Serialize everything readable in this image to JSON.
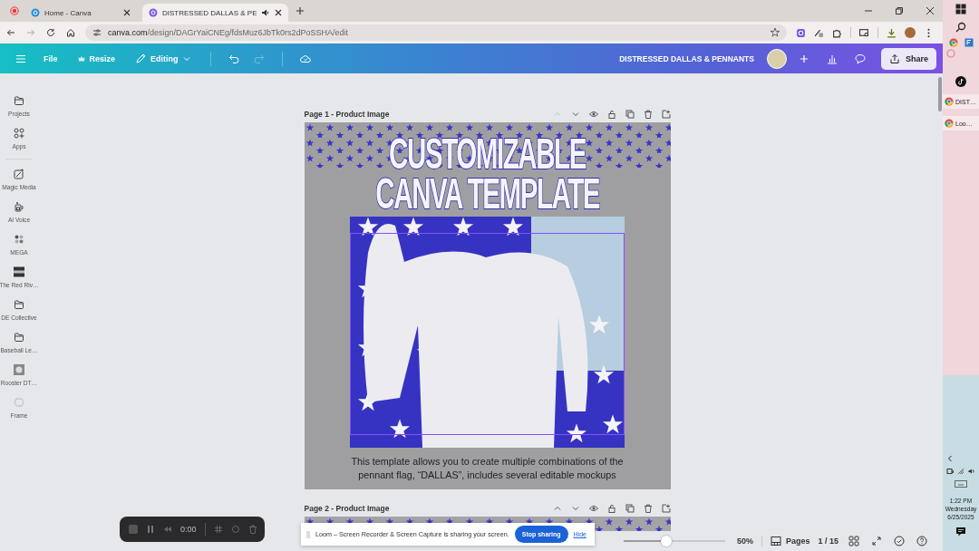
{
  "browser": {
    "tabs": [
      {
        "title": "Home - Canva",
        "selected": false,
        "audio": false
      },
      {
        "title": "DISTRESSED DALLAS & PE",
        "selected": true,
        "audio": true
      }
    ],
    "back_disabled": false,
    "forward_disabled": true,
    "url_host": "canva.com",
    "url_path": "/design/DAGrYaiCNEg/fdsMuz6JbTk0rs2dPoSSHA/edit"
  },
  "toolbar": {
    "file_label": "File",
    "resize_label": "Resize",
    "mode_label": "Editing",
    "undo_disabled": false,
    "redo_disabled": true,
    "design_title": "DISTRESSED DALLAS & PENNANTS",
    "share_label": "Share"
  },
  "sidebar": {
    "items": [
      {
        "label": "Projects",
        "kind": "folder"
      },
      {
        "label": "Apps",
        "kind": "apps"
      },
      {
        "label": "Magic Media",
        "kind": "magic"
      },
      {
        "label": "AI Voice",
        "kind": "voice"
      },
      {
        "label": "MEGA",
        "kind": "mega"
      },
      {
        "label": "The Red Riv…",
        "kind": "banner"
      },
      {
        "label": "DE Collective",
        "kind": "folder"
      },
      {
        "label": "Baseball Le…",
        "kind": "folder"
      },
      {
        "label": "Rooster DT…",
        "kind": "badge"
      },
      {
        "label": "Frame",
        "kind": "frame"
      }
    ]
  },
  "pages": [
    {
      "title": "Page 1 - Product Image",
      "move_up_disabled": true,
      "heading_lines": [
        "CUSTOMIZABLE",
        "CANVA TEMPLATE"
      ],
      "caption": "This template allows you to create multiple combinations of the pennant flag, “DALLAS”, includes several editable mockups"
    },
    {
      "title": "Page 2 - Product Image",
      "move_up_disabled": false
    }
  ],
  "footer": {
    "zoom": {
      "level": 0.42
    },
    "zoom_reading": "50%",
    "pages_label": "Pages",
    "page_count": "1 / 15"
  },
  "recorder": {
    "time": "0:00"
  },
  "share_notice": {
    "message": "Loom – Screen Recorder & Screen Capture is sharing your screen.",
    "stop_label": "Stop sharing",
    "hide_label": "Hide"
  },
  "taskbar": {
    "apps": [
      {
        "label": "DIST…"
      },
      {
        "label": "Loo…"
      }
    ],
    "time": "1:22 PM",
    "day": "Wednesday",
    "date": "6/25/2025"
  }
}
